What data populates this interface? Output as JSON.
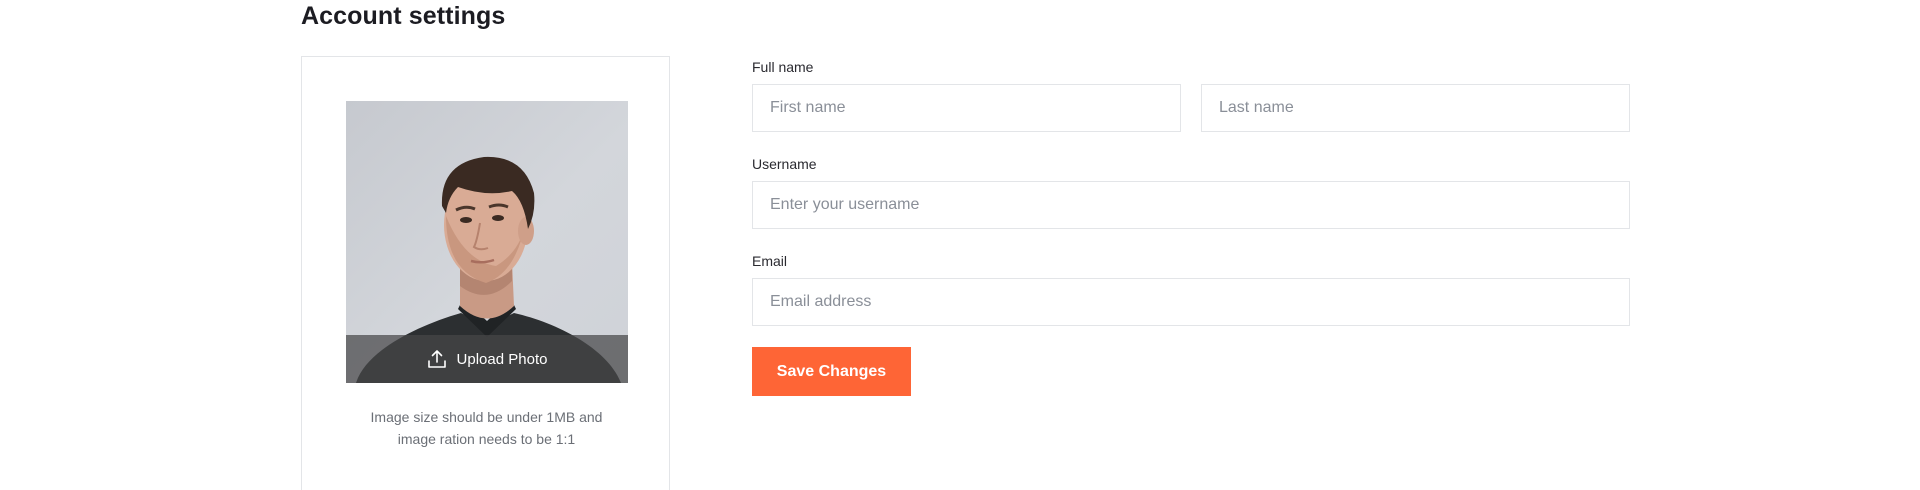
{
  "page": {
    "title": "Account settings"
  },
  "photo": {
    "upload_label": "Upload Photo",
    "upload_icon": "upload-icon",
    "hint_line_1": "Image size should be under 1MB and",
    "hint_line_2": "image ration needs to be 1:1"
  },
  "form": {
    "full_name_label": "Full name",
    "first_name_placeholder": "First name",
    "last_name_placeholder": "Last name",
    "username_label": "Username",
    "username_placeholder": "Enter your username",
    "email_label": "Email",
    "email_placeholder": "Email address",
    "save_label": "Save Changes"
  },
  "colors": {
    "accent": "#fe6536",
    "border": "#e3e5e8",
    "placeholder": "#8a8f98"
  }
}
